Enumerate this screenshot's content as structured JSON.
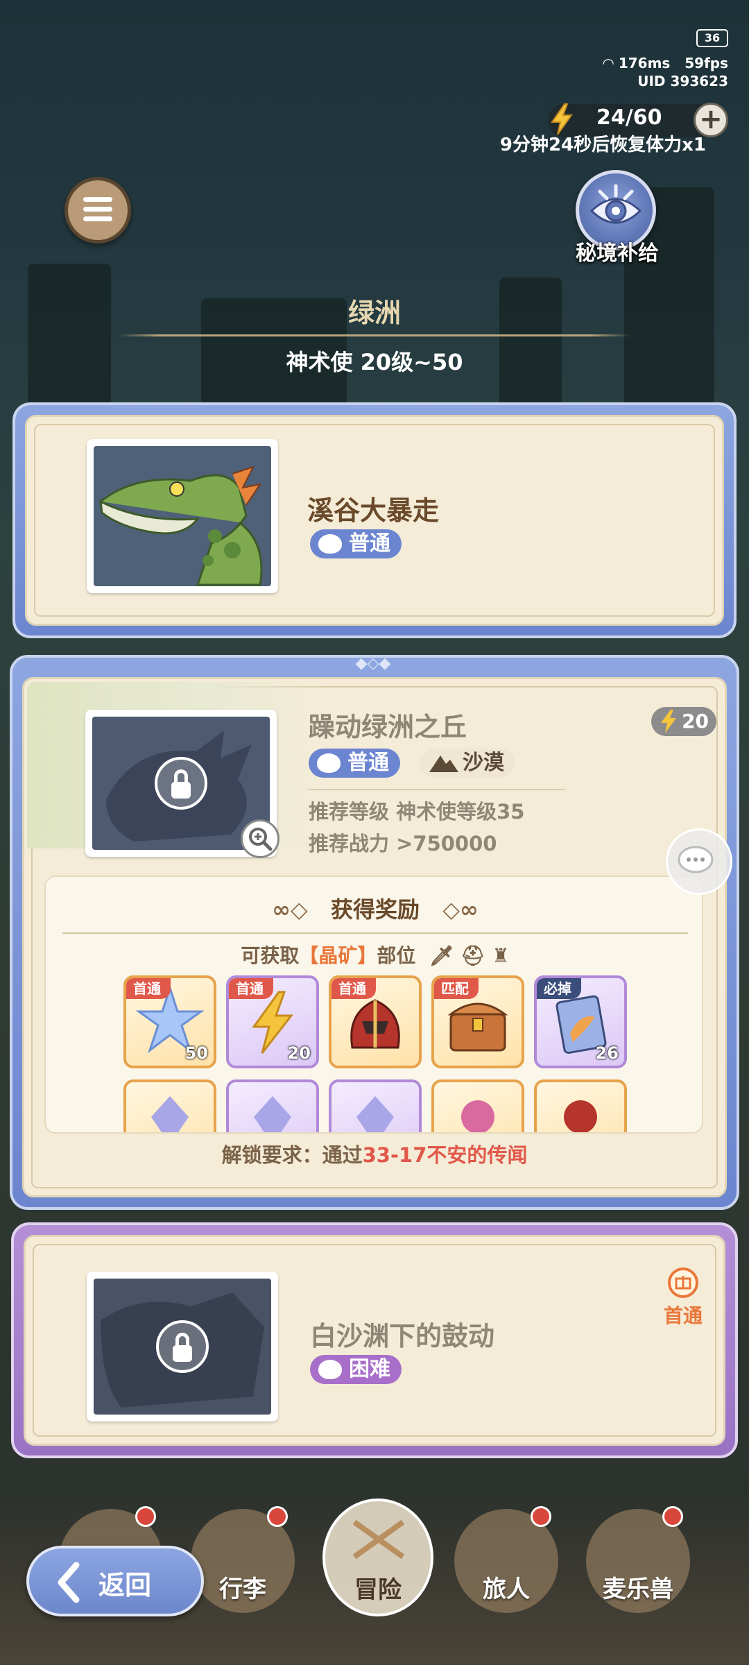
{
  "status": {
    "battery": "36",
    "ping": "176ms",
    "fps": "59fps",
    "uid": "UID 393623"
  },
  "stamina": {
    "value": "24/60",
    "recover_text": "9分钟24秒后恢复体力x1"
  },
  "secret_supply": {
    "label": "秘境补给"
  },
  "region": {
    "title": "绿洲",
    "subtitle": "神术使 20级~50"
  },
  "stages": [
    {
      "name": "溪谷大暴走",
      "difficulty": "普通"
    },
    {
      "name": "躁动绿洲之丘",
      "difficulty": "普通",
      "terrain": "沙漠",
      "cost": "20",
      "rec_level": "推荐等级 神术使等级35",
      "rec_power": "推荐战力 >750000",
      "rewards_title": "获得奖励",
      "obtainable_prefix": "可获取",
      "obtainable_highlight": "【晶矿】",
      "obtainable_suffix": "部位",
      "rewards": [
        {
          "badge": "首通",
          "qty": "50",
          "icon": "crystal-star-icon"
        },
        {
          "badge": "首通",
          "qty": "20",
          "icon": "lightning-icon"
        },
        {
          "badge": "首通",
          "qty": "",
          "icon": "helmet-icon"
        },
        {
          "badge": "匹配",
          "qty": "",
          "icon": "treasure-chest-icon"
        },
        {
          "badge": "必掉",
          "qty": "26",
          "icon": "ticket-icon"
        }
      ],
      "unlock_prefix": "解锁要求：通过",
      "unlock_highlight": "33-17不安的传闻"
    },
    {
      "name": "白沙渊下的鼓动",
      "difficulty": "困难",
      "first_clear": "首通"
    }
  ],
  "nav": {
    "back": "返回",
    "items": [
      "行李",
      "冒险",
      "旅人",
      "麦乐兽"
    ]
  },
  "colors": {
    "accent_blue": "#6c85d1",
    "accent_purple": "#a76fc9",
    "highlight_orange": "#e9773a",
    "highlight_red": "#e0584a"
  }
}
